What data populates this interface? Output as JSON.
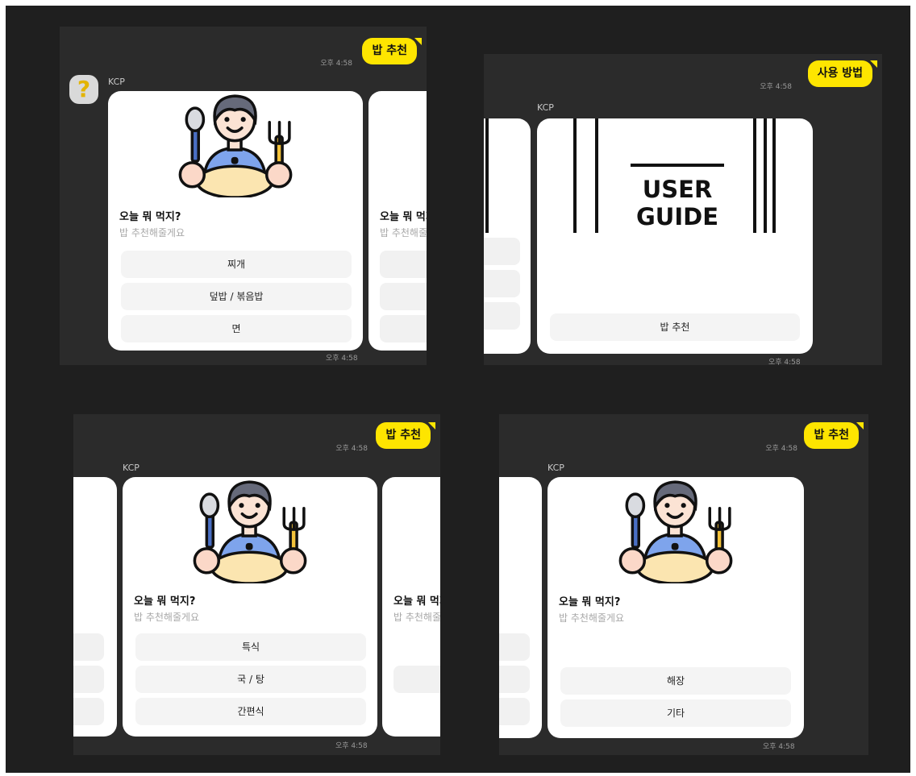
{
  "colors": {
    "canvas": "#1f1f1f",
    "panel": "#2b2b2b",
    "bubble": "#fee500",
    "card": "#ffffff"
  },
  "panels": {
    "tl": {
      "bubble": "밥 추천",
      "time_sent": "오후 4:58",
      "sender": "KCP",
      "avatar_icon": "?",
      "card_main": {
        "title": "오늘 뭐 먹지?",
        "subtitle": "밥 추천해줄게요",
        "buttons": [
          "찌개",
          "덮밥 / 볶음밥",
          "면"
        ]
      },
      "card_next": {
        "title": "오늘 뭐 먹지?",
        "subtitle": "밥 추천해줄게요"
      },
      "time_recv": "오후 4:58"
    },
    "tr": {
      "bubble": "사용 방법",
      "time_sent": "오후 4:58",
      "sender": "KCP",
      "card_main": {
        "guide_line1": "USER",
        "guide_line2": "GUIDE",
        "button": "밥 추천"
      },
      "time_recv": "오후 4:58"
    },
    "bl": {
      "bubble": "밥 추천",
      "time_sent": "오후 4:58",
      "sender": "KCP",
      "card_main": {
        "title": "오늘 뭐 먹지?",
        "subtitle": "밥 추천해줄게요",
        "buttons": [
          "특식",
          "국 / 탕",
          "간편식"
        ]
      },
      "card_next": {
        "title": "오늘 뭐 먹지?",
        "subtitle": "밥 추천해줄게요"
      },
      "time_recv": "오후 4:58"
    },
    "br": {
      "bubble": "밥 추천",
      "time_sent": "오후 4:58",
      "sender": "KCP",
      "card_main": {
        "title": "오늘 뭐 먹지?",
        "subtitle": "밥 추천해줄게요",
        "buttons": [
          "해장",
          "기타"
        ]
      },
      "time_recv": "오후 4:58"
    }
  }
}
